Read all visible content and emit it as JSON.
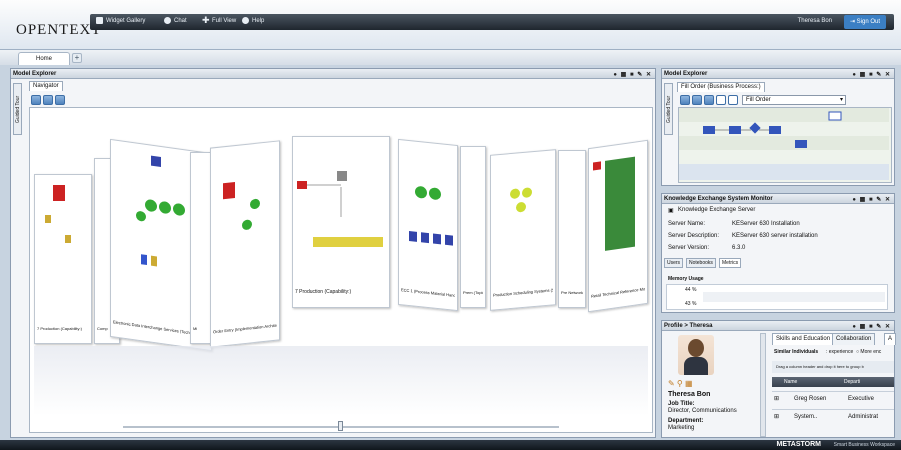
{
  "brand": {
    "logo": "OpenText"
  },
  "navbar": {
    "widget_gallery": "Widget Gallery",
    "chat": "Chat",
    "full_view": "Full View",
    "help": "Help",
    "user": "Theresa Bon",
    "sign_out": "Sign Out"
  },
  "tabs": {
    "home": "Home",
    "add": "+"
  },
  "model_explorer_left": {
    "title": "Model Explorer",
    "guided_tour": "Guided Tour",
    "subtab": "Navigator",
    "cards": [
      "7 Production (Capability:)",
      "Comp",
      "Electronic Data Interchange Services (Technical)",
      "Mi",
      "Order Entry (Implementation Architecture)",
      "7 Production (Capability:)",
      "ECC 1 (Process Material Handling (Basic))",
      "Prem (Topic)",
      "Production Scheduling Systems (Systems)",
      "Pre Network (Topic)",
      "Retail Technical Reference Model (Platforms)"
    ],
    "center_label": "7 Production (Capability:)"
  },
  "model_explorer_right": {
    "title": "Model Explorer",
    "guided_tour": "Guided Tour",
    "subtab": "Fill Order (Business Process:)",
    "select_value": "Fill Order"
  },
  "kes_monitor": {
    "title": "Knowledge Exchange System Monitor",
    "header": "Knowledge Exchange Server",
    "server_name_label": "Server Name:",
    "server_name": "KEServer 630 Installation",
    "server_desc_label": "Server Description:",
    "server_desc": "KEServer 630 server installation",
    "server_version_label": "Server Version:",
    "server_version": "6.3.0",
    "tabs": [
      "Users",
      "Notebooks",
      "Metrics"
    ],
    "memory_usage_label": "Memory Usage",
    "memory_value_1": "44 %",
    "memory_value_2": "43 %"
  },
  "profile": {
    "title": "Profile > Theresa",
    "name": "Theresa Bon",
    "job_title_label": "Job Title:",
    "job_title": "Director, Communications",
    "department_label": "Department:",
    "department": "Marketing",
    "tabs": [
      "Skills and Education",
      "Collaboration",
      "A"
    ],
    "similar_label": "Similar Individuals",
    "radio1": "experience",
    "radio2": "More enc",
    "drag_hint": "Drag a column header and drop it here to group b",
    "col_name": "Name",
    "col_dept": "Departi",
    "rows": [
      {
        "name": "Greg Rosen",
        "dept": "Executive"
      },
      {
        "name": "System..",
        "dept": "Administrat"
      }
    ]
  },
  "footer": {
    "brand": "METASTORM",
    "tagline": "Smart Business Workspace"
  },
  "colors": {
    "accent": "#3b7fc4",
    "navbar": "#1f262e"
  }
}
